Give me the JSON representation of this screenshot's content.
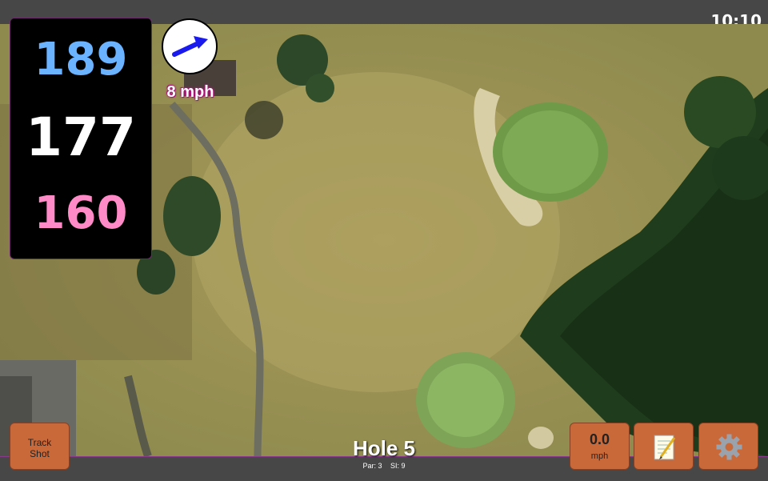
{
  "status": {
    "time": "10:10"
  },
  "distances": {
    "back": "189",
    "middle": "177",
    "front": "160"
  },
  "wind": {
    "speed_label": "8 mph",
    "direction_icon": "arrow-icon"
  },
  "hole": {
    "title": "Hole 5",
    "par": "Par: 3",
    "stroke_index": "SI: 9"
  },
  "buttons": {
    "track_line1": "Track",
    "track_line2": "Shot",
    "wind_value": "0.0",
    "wind_unit": "mph",
    "notes_icon": "notepad-icon",
    "settings_icon": "gear-icon"
  },
  "colors": {
    "back_distance": "#6bb3ff",
    "middle_distance": "#ffffff",
    "front_distance": "#ff8ac8",
    "button": "#c9693a",
    "wind_label_outline": "#b0127a"
  }
}
